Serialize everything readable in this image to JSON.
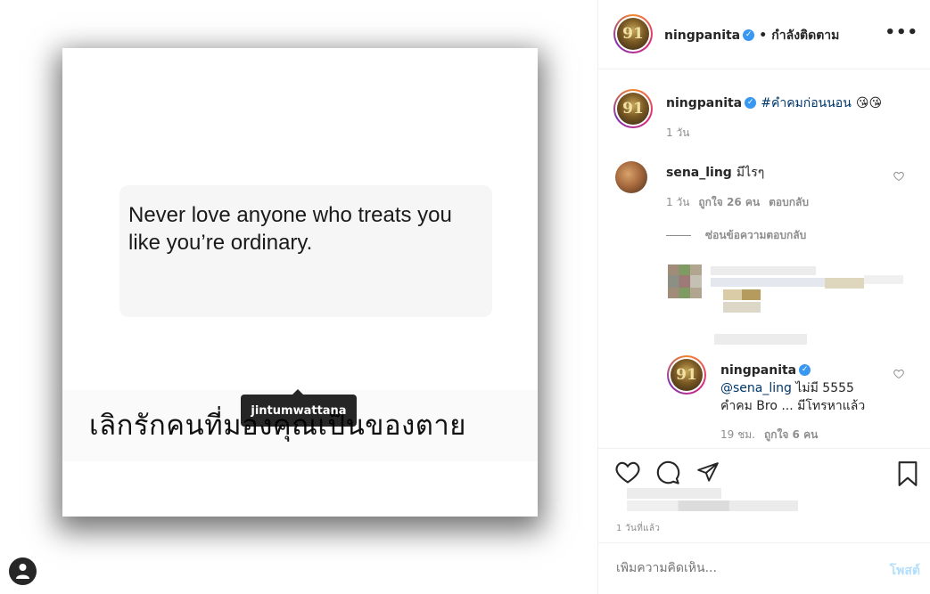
{
  "photo": {
    "quote": "Never love anyone who treats you like you’re ordinary.",
    "thai_caption": "เลิกรักคนที่มองคุณเป็นของตาย",
    "tag_user": "jintumwattana"
  },
  "header": {
    "username": "ningpanita",
    "verified_mark": "✓",
    "separator": "•",
    "follow_status": "กำลังติดตาม",
    "more_label": "•••"
  },
  "caption": {
    "username": "ningpanita",
    "hashtag": "#คำคมก่อนนอน",
    "emojis": "😘😘",
    "time": "1 วัน"
  },
  "comments": [
    {
      "username": "sena_ling",
      "text": "มีไรๆ",
      "time": "1 วัน",
      "likes": "ถูกใจ 26 คน",
      "reply": "ตอบกลับ",
      "view_replies": "ซ่อนข้อความตอบกลับ"
    }
  ],
  "reply": {
    "username": "ningpanita",
    "mention": "@sena_ling",
    "text_line1": " ไม่มี 5555",
    "text_line2": "คำคม Bro ... มีโทรหาแล้ว",
    "time": "19 ชม.",
    "likes": "ถูกใจ 6 คน"
  },
  "avatar_text": "91",
  "footer": {
    "time_ago": "1 วันที่แล้ว",
    "comment_placeholder": "เพิ่มความคิดเห็น...",
    "post_label": "โพสต์"
  },
  "colors": {
    "link": "#00376b",
    "verified": "#3897f0",
    "post_disabled": "#b2dffc"
  }
}
